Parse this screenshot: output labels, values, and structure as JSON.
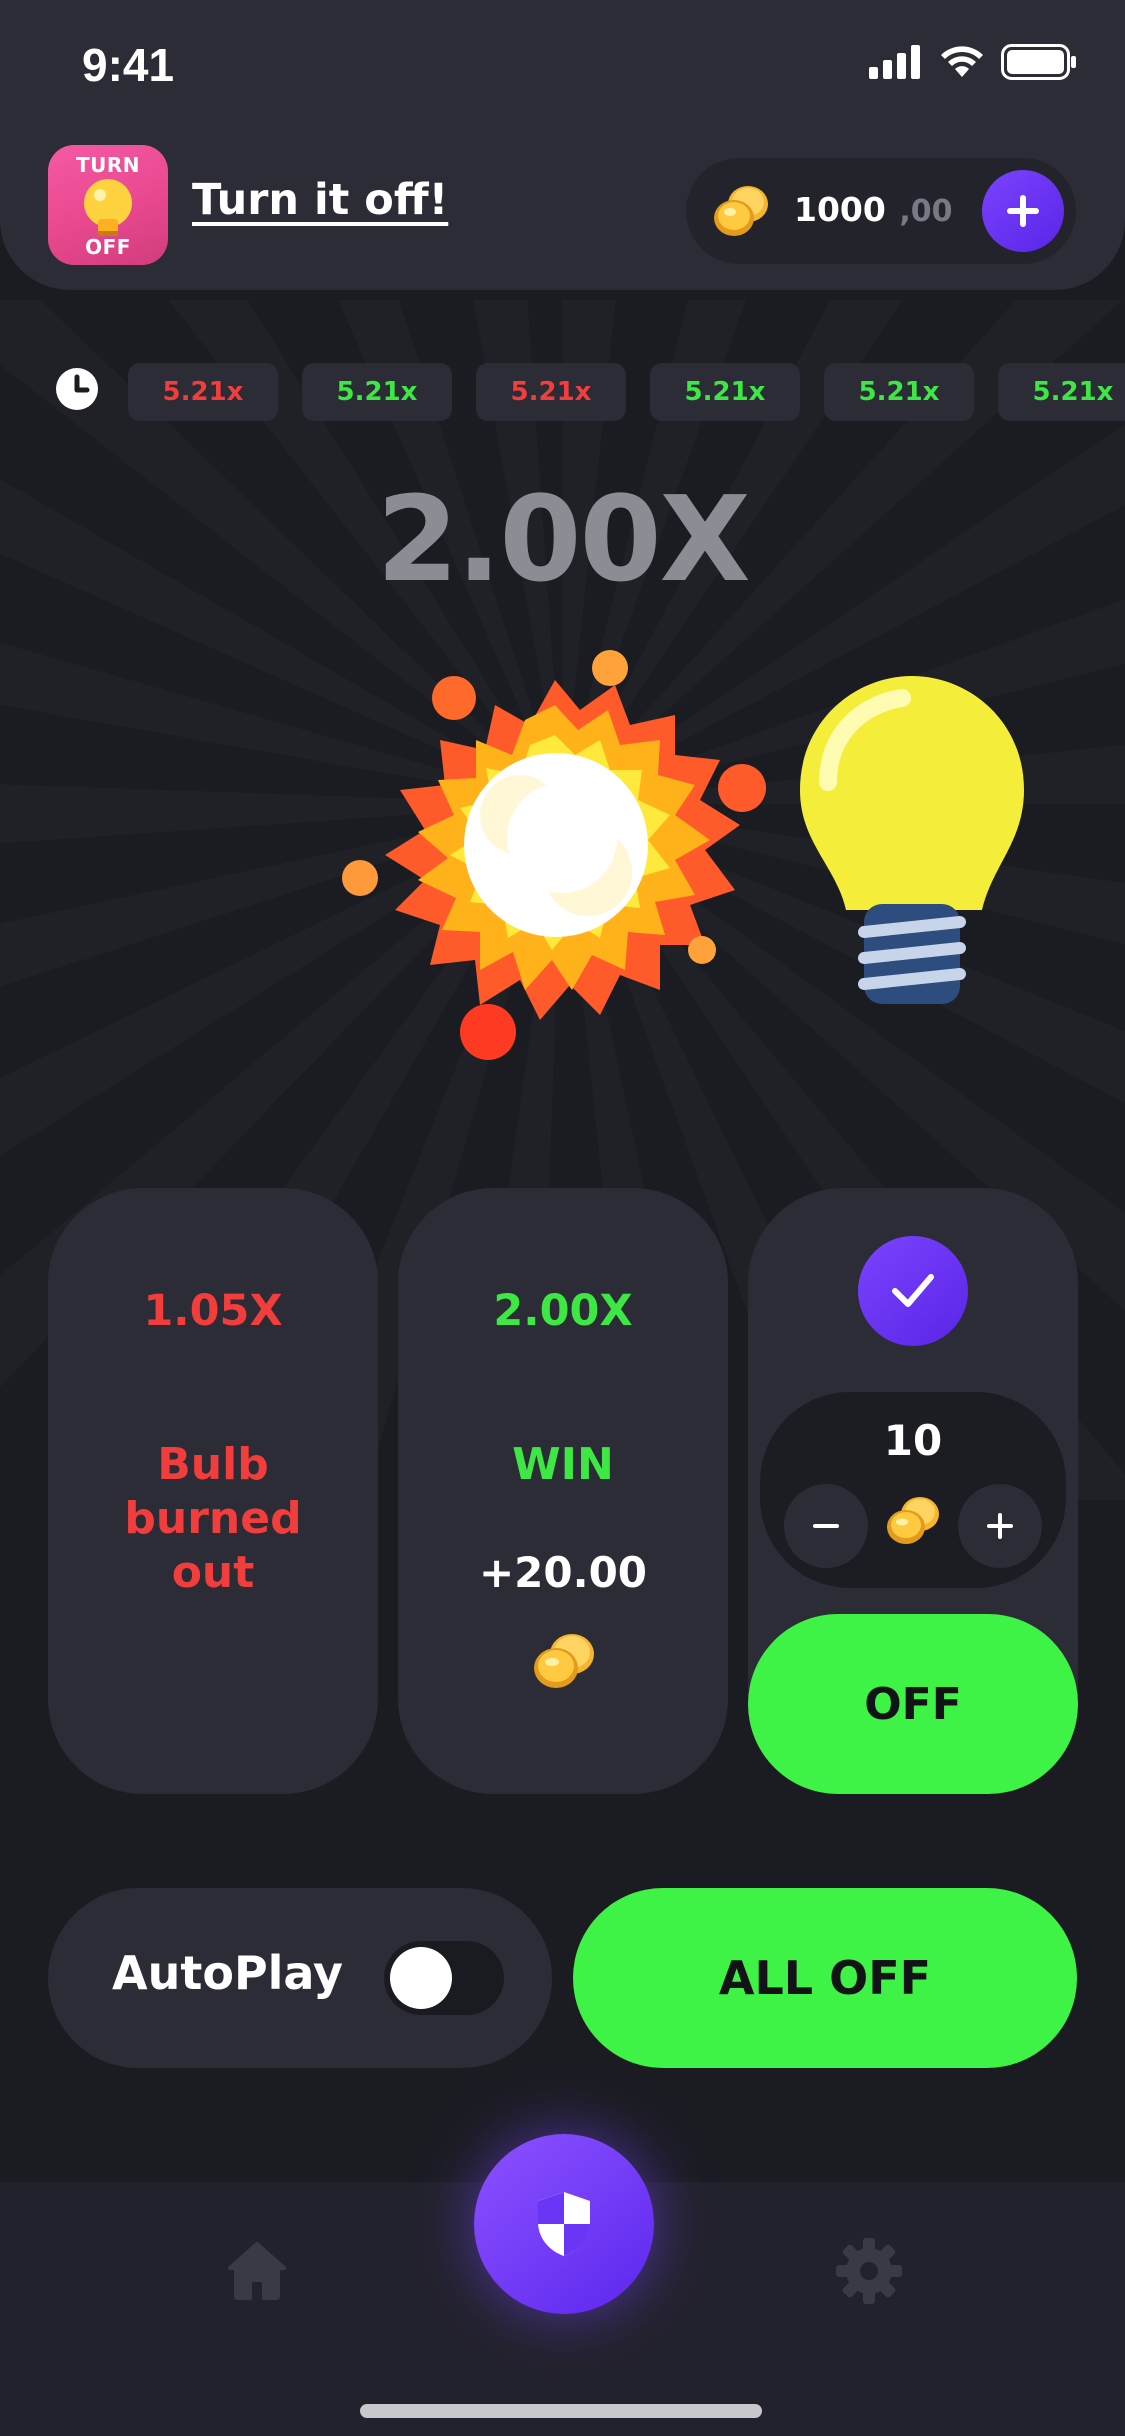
{
  "status_bar": {
    "time": "9:41"
  },
  "header": {
    "app_icon_text_top": "TURN",
    "app_icon_text_bottom": "OFF",
    "title": "Turn it off!",
    "balance_main": "1000",
    "balance_cents": ",00"
  },
  "history": [
    {
      "value": "5.21x",
      "color": "red"
    },
    {
      "value": "5.21x",
      "color": "green"
    },
    {
      "value": "5.21x",
      "color": "red"
    },
    {
      "value": "5.21x",
      "color": "green"
    },
    {
      "value": "5.21x",
      "color": "green"
    },
    {
      "value": "5.21x",
      "color": "green"
    }
  ],
  "game": {
    "current_multiplier": "2.00X"
  },
  "cards": {
    "lost": {
      "multiplier": "1.05X",
      "status": "Bulb burned out"
    },
    "win": {
      "multiplier": "2.00X",
      "status": "WIN",
      "amount": "+20.00"
    },
    "bet": {
      "value": "10",
      "off_label": "OFF"
    }
  },
  "controls": {
    "autoplay_label": "AutoPlay",
    "autoplay_on": false,
    "all_off_label": "ALL OFF"
  },
  "colors": {
    "accent_purple": "#6a35f5",
    "green": "#3ff346",
    "red": "#f23d3d",
    "panel": "#2b2c35",
    "background": "#1b1c22"
  }
}
